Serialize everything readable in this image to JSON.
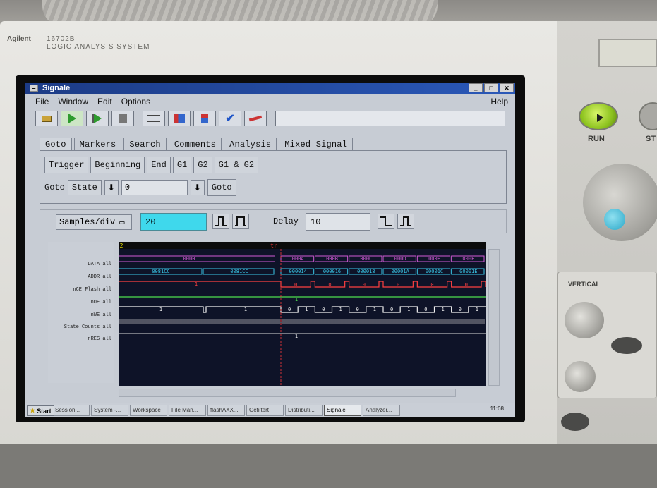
{
  "device": {
    "brand": "Agilent",
    "model": "16702B",
    "subtitle": "LOGIC ANALYSIS SYSTEM",
    "run_label": "RUN",
    "stop_label": "ST",
    "vertical_label": "VERTICAL"
  },
  "window": {
    "title": "Signale"
  },
  "menu": {
    "file": "File",
    "window": "Window",
    "edit": "Edit",
    "options": "Options",
    "help": "Help"
  },
  "tabs": [
    "Goto",
    "Markers",
    "Search",
    "Comments",
    "Analysis",
    "Mixed Signal"
  ],
  "goto_buttons": [
    "Trigger",
    "Beginning",
    "End",
    "G1",
    "G2",
    "G1 & G2"
  ],
  "goto_row": {
    "label": "Goto",
    "mode": "State",
    "value": "0",
    "go": "Goto"
  },
  "controls": {
    "samples_label": "Samples/div",
    "samples_value": "20",
    "delay_label": "Delay",
    "delay_value": "10"
  },
  "signals": [
    "DATA all",
    "ADDR all",
    "nCE_Flash all",
    "nOE all",
    "nWE all",
    "State Counts all",
    "nRES all"
  ],
  "waveform": {
    "marker_g2": "2",
    "trigger_label": "tr",
    "data_values": [
      "0000",
      "000A",
      "000B",
      "000C",
      "000D",
      "000E",
      "000F"
    ],
    "addr_values": [
      "0081CC",
      "0081CC",
      "000014",
      "000016",
      "000018",
      "00001A",
      "00001C",
      "00001E"
    ],
    "nce_label": "1",
    "nce_pulse_values": [
      "0",
      "0",
      "0",
      "0",
      "0",
      "0"
    ],
    "noe_label": "1",
    "nwe_values": [
      "1",
      "1",
      "0",
      "1",
      "0",
      "1",
      "0",
      "1",
      "0",
      "1",
      "0",
      "1",
      "0",
      "1"
    ],
    "nres_label": "1",
    "colors": {
      "data": "#d15bd6",
      "addr": "#39c7e8",
      "nce": "#ff4040",
      "noe": "#4fe04f",
      "nwe": "#f2f2f2",
      "trigger": "#ff3b3b"
    }
  },
  "taskbar": {
    "start": "Start",
    "tasks": [
      "Session...",
      "System -...",
      "Workspace",
      "File Man...",
      "flashAXX...",
      "Gefiltert",
      "Distributi...",
      "Signale",
      "Analyzer..."
    ],
    "active_index": 7,
    "clock": "11:08"
  }
}
